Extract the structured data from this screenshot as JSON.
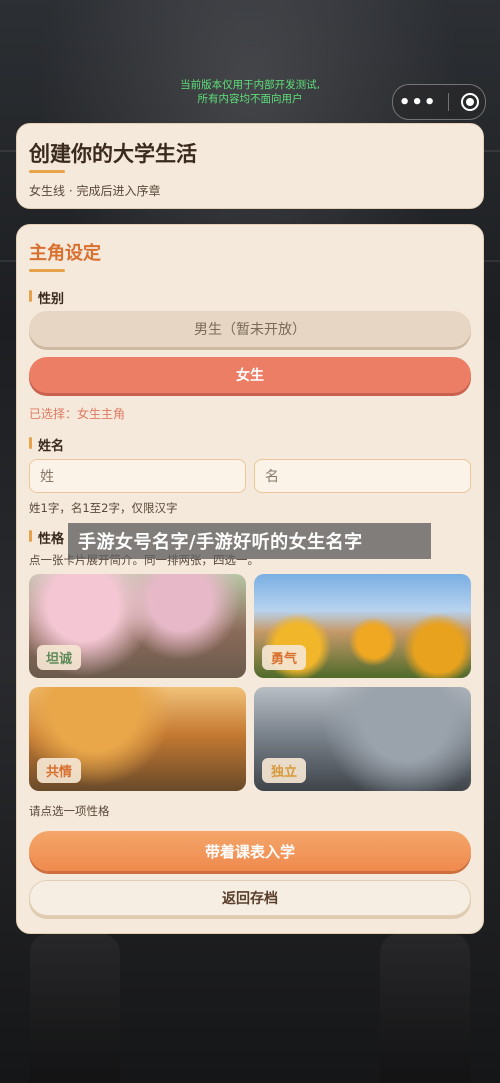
{
  "dev_notice": {
    "line1": "当前版本仅用于内部开发测试,",
    "line2": "所有内容均不面向用户"
  },
  "capsule": {
    "menu_icon": "more-dots-icon",
    "close_icon": "target-circle-icon"
  },
  "header": {
    "title": "创建你的大学生活",
    "subtitle": "女生线 · 完成后进入序章"
  },
  "protagonist": {
    "section_title": "主角设定",
    "gender": {
      "label": "性别",
      "male_option": "男生（暂未开放）",
      "female_option": "女生",
      "selected_note": "已选择：女生主角"
    },
    "name": {
      "label": "姓名",
      "surname_placeholder": "姓",
      "given_placeholder": "名",
      "hint": "姓1字，名1至2字，仅限汉字"
    },
    "personality": {
      "label": "性格",
      "hint": "点一张卡片展开简介。同一排两张，四选一。",
      "options": [
        {
          "label": "坦诚",
          "color": "#5e8a5a"
        },
        {
          "label": "勇气",
          "color": "#d8702f"
        },
        {
          "label": "共情",
          "color": "#d8702f"
        },
        {
          "label": "独立",
          "color": "#d89a3a"
        }
      ],
      "prompt": "请点选一项性格"
    }
  },
  "actions": {
    "enroll": "带着课表入学",
    "back": "返回存档"
  },
  "watermark": "手游女号名字/手游好听的女生名字",
  "colors": {
    "accent": "#d8702f",
    "female_button": "#ec7e66",
    "card_bg": "#f4e9db",
    "notice_green": "#5fe07a"
  }
}
